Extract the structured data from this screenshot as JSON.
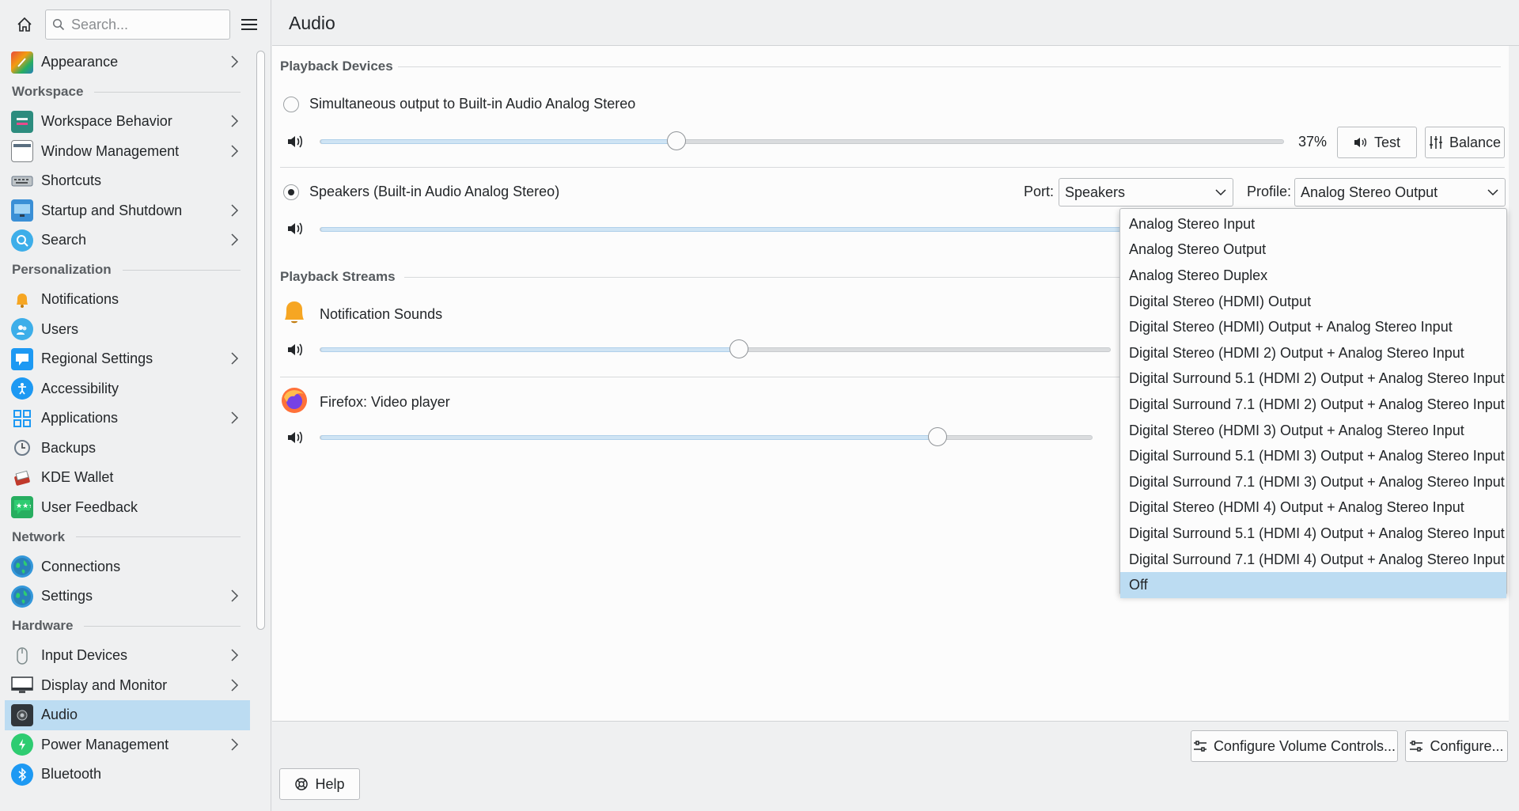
{
  "sidebar": {
    "search_placeholder": "Search...",
    "appearance": "Appearance",
    "cat_workspace": "Workspace",
    "workspace_behavior": "Workspace Behavior",
    "window_management": "Window Management",
    "shortcuts": "Shortcuts",
    "startup_shutdown": "Startup and Shutdown",
    "search": "Search",
    "cat_personalization": "Personalization",
    "notifications": "Notifications",
    "users": "Users",
    "regional_settings": "Regional Settings",
    "accessibility": "Accessibility",
    "applications": "Applications",
    "backups": "Backups",
    "kde_wallet": "KDE Wallet",
    "user_feedback": "User Feedback",
    "cat_network": "Network",
    "connections": "Connections",
    "settings": "Settings",
    "cat_hardware": "Hardware",
    "input_devices": "Input Devices",
    "display_monitor": "Display and Monitor",
    "audio": "Audio",
    "power_management": "Power Management",
    "bluetooth": "Bluetooth"
  },
  "header": {
    "title": "Audio"
  },
  "playback_devices": {
    "section_title": "Playback Devices",
    "device1": {
      "name": "Simultaneous output to Built-in Audio Analog Stereo",
      "volume_label": "37%",
      "volume": 0.37,
      "selected": false
    },
    "test_label": "Test",
    "balance_label": "Balance",
    "device2": {
      "name": "Speakers (Built-in Audio Analog Stereo)",
      "selected": true
    },
    "port_label": "Port:",
    "port_value": "Speakers",
    "profile_label": "Profile:",
    "profile_value": "Analog Stereo Output"
  },
  "playback_streams": {
    "section_title": "Playback Streams",
    "stream1": {
      "name": "Notification Sounds",
      "volume": 0.53
    },
    "stream2": {
      "name": "Firefox: Video player",
      "volume": 0.8
    }
  },
  "profile_dropdown": {
    "options": [
      "Analog Stereo Input",
      "Analog Stereo Output",
      "Analog Stereo Duplex",
      "Digital Stereo (HDMI) Output",
      "Digital Stereo (HDMI) Output + Analog Stereo Input",
      "Digital Stereo (HDMI 2) Output + Analog Stereo Input",
      "Digital Surround 5.1 (HDMI 2) Output + Analog Stereo Input",
      "Digital Surround 7.1 (HDMI 2) Output + Analog Stereo Input",
      "Digital Stereo (HDMI 3) Output + Analog Stereo Input",
      "Digital Surround 5.1 (HDMI 3) Output + Analog Stereo Input",
      "Digital Surround 7.1 (HDMI 3) Output + Analog Stereo Input",
      "Digital Stereo (HDMI 4) Output + Analog Stereo Input",
      "Digital Surround 5.1 (HDMI 4) Output + Analog Stereo Input",
      "Digital Surround 7.1 (HDMI 4) Output + Analog Stereo Input",
      "Off"
    ],
    "highlighted": "Off"
  },
  "footer": {
    "configure_volume_controls": "Configure Volume Controls...",
    "configure": "Configure...",
    "help": "Help"
  },
  "colors": {
    "accent": "#3daee9",
    "selection": "#bcdcf2"
  }
}
